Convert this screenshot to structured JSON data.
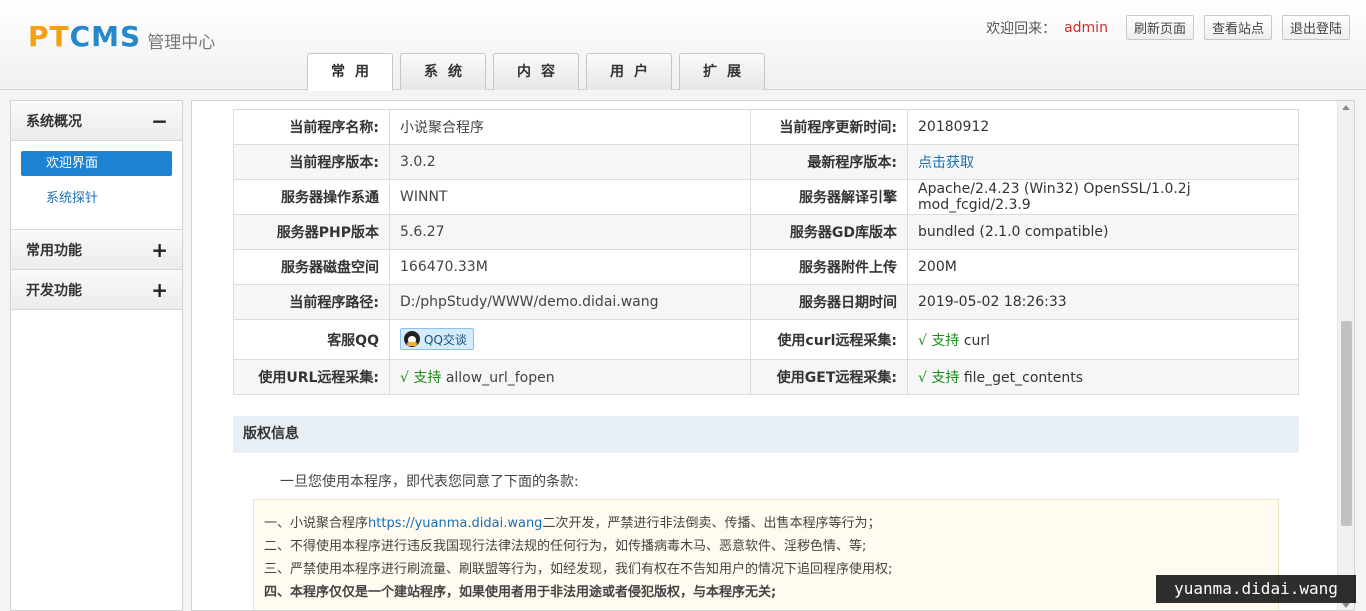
{
  "header": {
    "logo_text_a": "PT",
    "logo_text_b": "CMS",
    "logo_sub": "管理中心",
    "welcome": "欢迎回来：",
    "username": "admin",
    "buttons": [
      "刷新页面",
      "查看站点",
      "退出登陆"
    ]
  },
  "tabs": [
    {
      "label": "常用",
      "active": true
    },
    {
      "label": "系统",
      "active": false
    },
    {
      "label": "内容",
      "active": false
    },
    {
      "label": "用户",
      "active": false
    },
    {
      "label": "扩展",
      "active": false
    }
  ],
  "sidebar": {
    "sections": [
      {
        "title": "系统概况",
        "sign": "−",
        "items": [
          {
            "label": "欢迎界面",
            "active": true
          },
          {
            "label": "系统探针",
            "active": false
          }
        ]
      },
      {
        "title": "常用功能",
        "sign": "+"
      },
      {
        "title": "开发功能",
        "sign": "+"
      }
    ]
  },
  "info_table": {
    "rows": [
      {
        "l1": "当前程序名称:",
        "v1": "小说聚合程序",
        "l2": "当前程序更新时间:",
        "v2": "20180912"
      },
      {
        "l1": "当前程序版本:",
        "v1": "3.0.2",
        "l2": "最新程序版本:",
        "v2": "点击获取"
      },
      {
        "l1": "服务器操作系通",
        "v1": "WINNT",
        "l2": "服务器解译引擎",
        "v2": "Apache/2.4.23 (Win32) OpenSSL/1.0.2j mod_fcgid/2.3.9"
      },
      {
        "l1": "服务器PHP版本",
        "v1": "5.6.27",
        "l2": "服务器GD库版本",
        "v2": "bundled (2.1.0 compatible)"
      },
      {
        "l1": "服务器磁盘空间",
        "v1": "166470.33M",
        "l2": "服务器附件上传",
        "v2": "200M"
      },
      {
        "l1": "当前程序路径:",
        "v1": "D:/phpStudy/WWW/demo.didai.wang",
        "l2": "服务器日期时间",
        "v2": "2019-05-02 18:26:33"
      },
      {
        "l1": "客服QQ",
        "v1": "QQ交谈",
        "l2": "使用curl远程采集:",
        "v2_ok": "√ 支持",
        "v2": " curl"
      },
      {
        "l1": "使用URL远程采集:",
        "v1_ok": "√ 支持",
        "v1": " allow_url_fopen",
        "l2": "使用GET远程采集:",
        "v2_ok": "√ 支持",
        "v2": " file_get_contents"
      }
    ]
  },
  "copyright": {
    "title": "版权信息",
    "intro": "一旦您使用本程序，即代表您同意了下面的条款:",
    "t1_pre": "一、小说聚合程序",
    "t1_link": "https://yuanma.didai.wang",
    "t1_post": "二次开发，严禁进行非法倒卖、传播、出售本程序等行为；",
    "t2": "二、不得使用本程序进行违反我国现行法律法规的任何行为，如传播病毒木马、恶意软件、淫秽色情、等;",
    "t3": "三、严禁使用本程序进行刷流量、刷联盟等行为，如经发现，我们有权在不告知用户的情况下追回程序使用权;",
    "t4": "四、本程序仅仅是一个建站程序，如果使用者用于非法用途或者侵犯版权，与本程序无关;"
  },
  "watermark": "yuanma.didai.wang"
}
